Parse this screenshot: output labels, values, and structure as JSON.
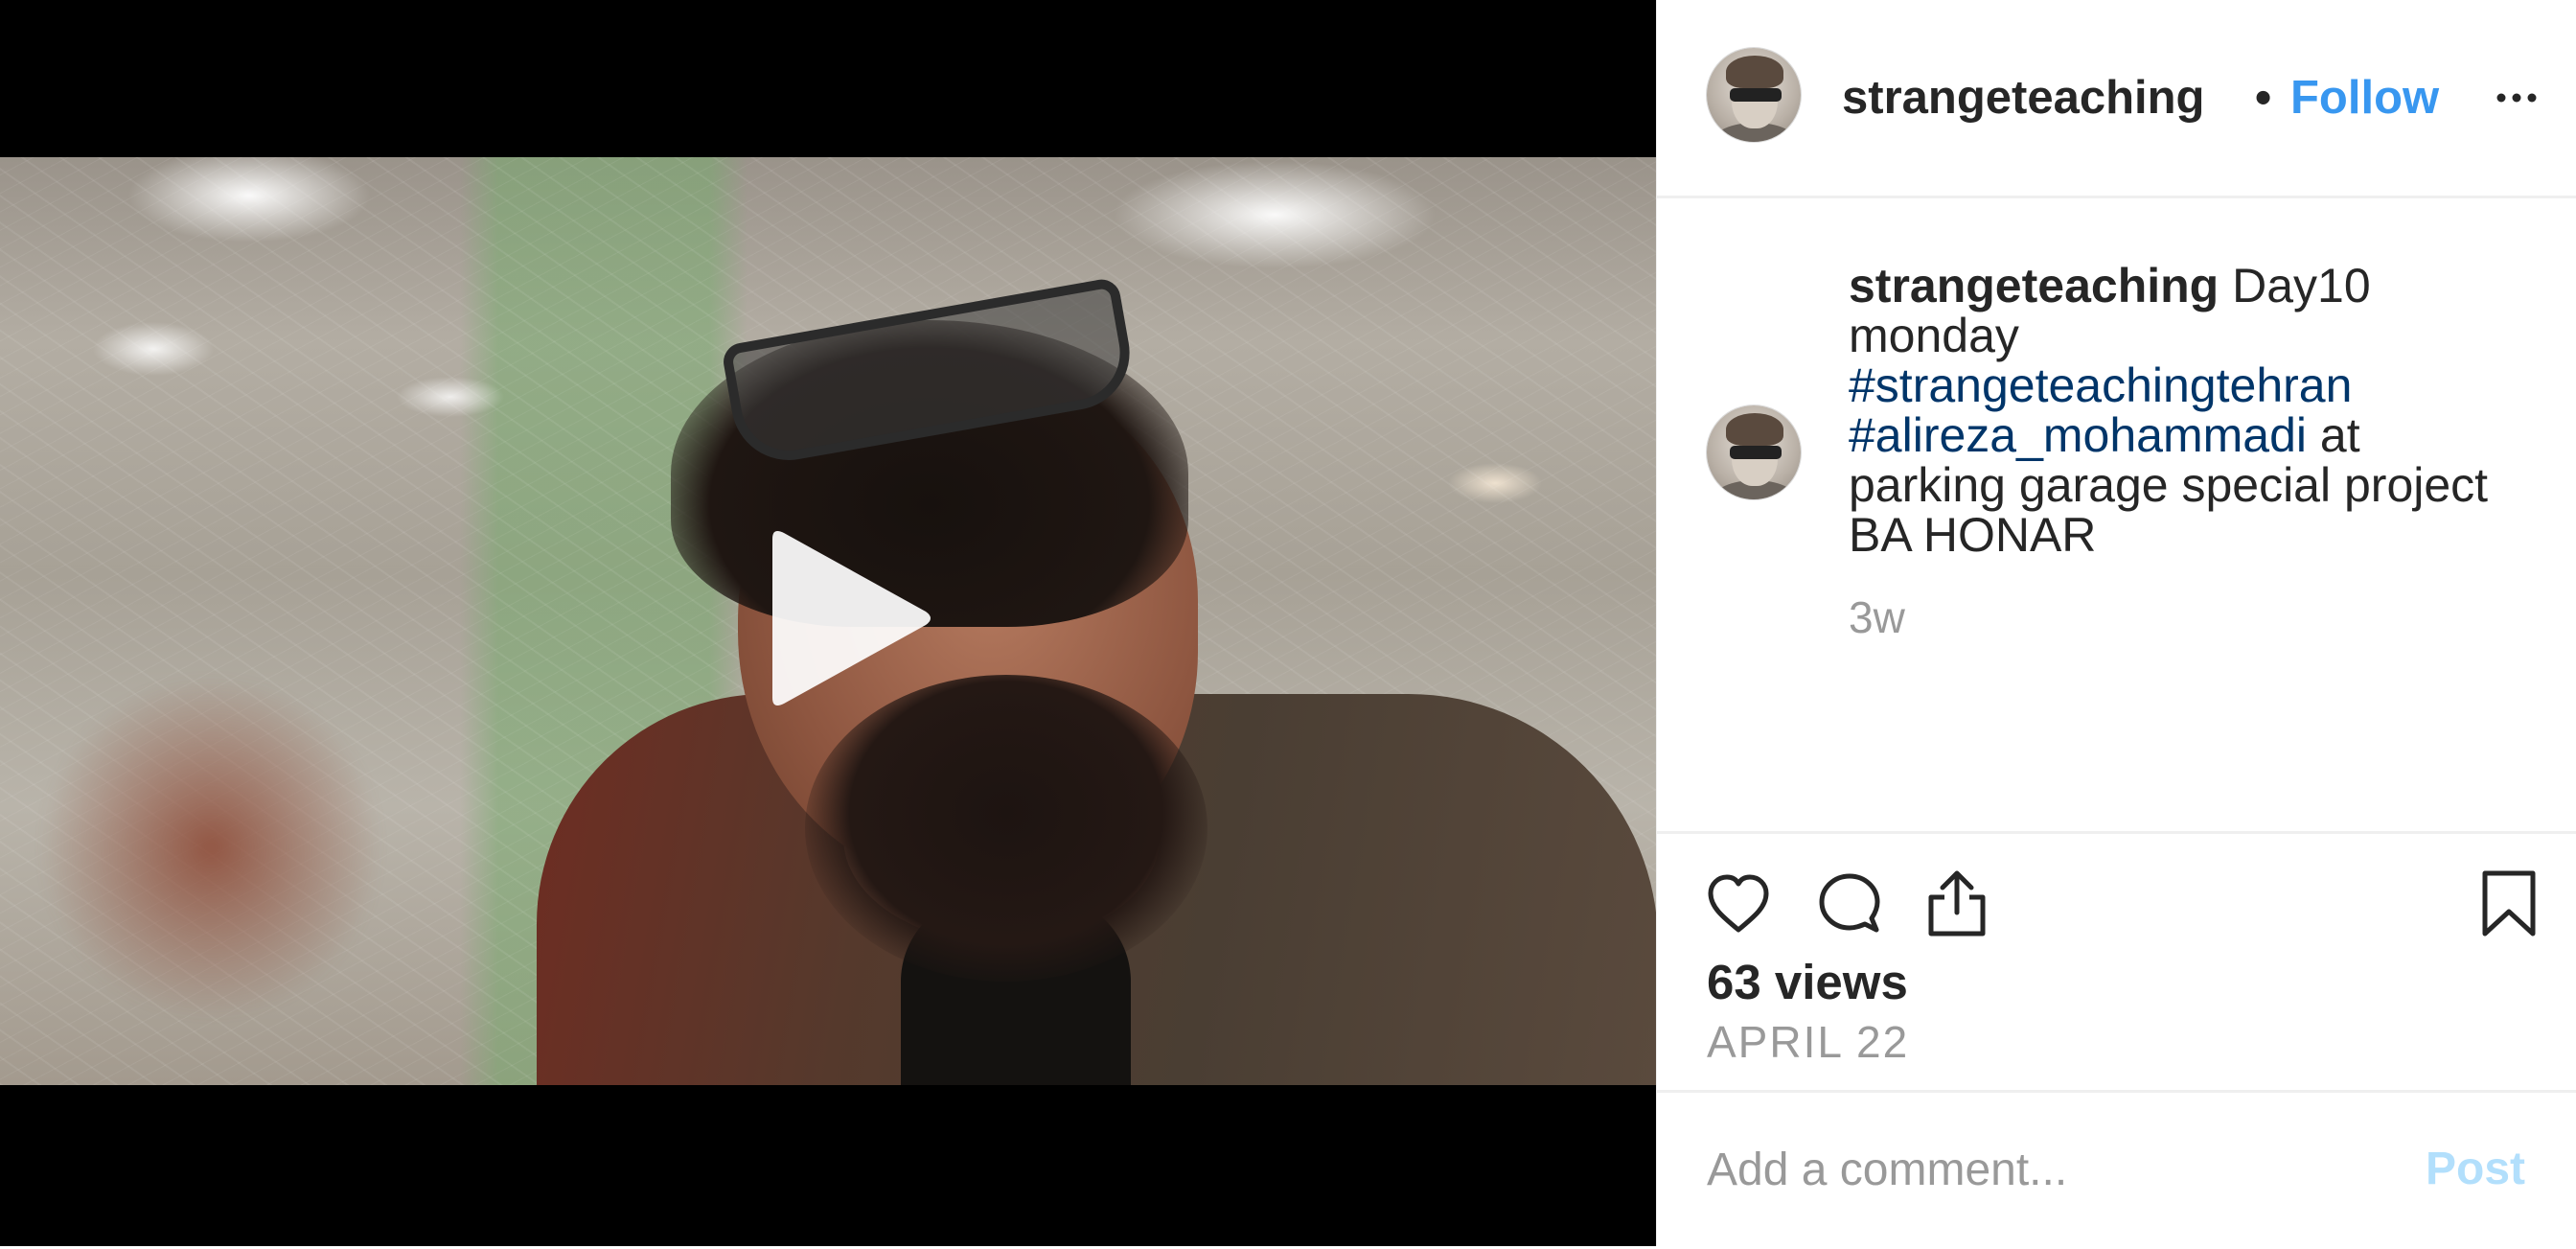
{
  "post": {
    "username": "strangeteaching",
    "separator": "•",
    "follow_label": "Follow",
    "more_icon": "more-horizontal-icon",
    "play_icon": "play-icon"
  },
  "caption": {
    "username": "strangeteaching",
    "text_1": " Day10 monday ",
    "hashtag_1": "#strangeteachingtehran",
    "space": " ",
    "hashtag_2": "#alireza_mohammadi",
    "text_2": " at parking garage special project BA HONAR",
    "time_ago": "3w"
  },
  "stats": {
    "views": "63 views",
    "date": "APRIL 22"
  },
  "icons": {
    "like": "heart-icon",
    "comment": "comment-icon",
    "share": "share-icon",
    "save": "bookmark-icon"
  },
  "comment": {
    "placeholder": "Add a comment...",
    "post_label": "Post"
  },
  "colors": {
    "follow": "#3897f0",
    "hashtag": "#003569",
    "post_disabled": "#b2dffc",
    "muted_text": "#999999"
  }
}
